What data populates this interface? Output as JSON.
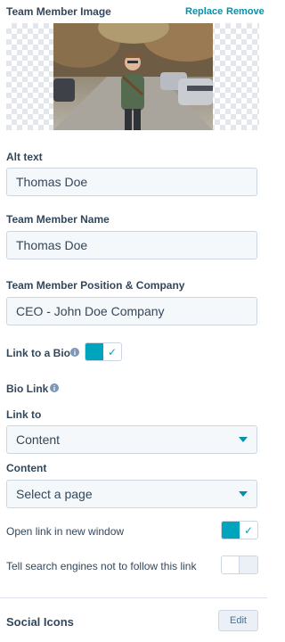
{
  "image_section": {
    "label": "Team Member Image",
    "replace_label": "Replace",
    "remove_label": "Remove"
  },
  "alt_text": {
    "label": "Alt text",
    "value": "Thomas Doe"
  },
  "name": {
    "label": "Team Member Name",
    "value": "Thomas Doe"
  },
  "position": {
    "label": "Team Member Position & Company",
    "value": "CEO - John Doe Company"
  },
  "link_to_bio": {
    "label": "Link to a Bio",
    "enabled": true,
    "info_icon": "info-icon"
  },
  "bio_link": {
    "label": "Bio Link",
    "info_icon": "info-icon"
  },
  "link_to": {
    "label": "Link to",
    "value": "Content"
  },
  "content": {
    "label": "Content",
    "placeholder": "Select a page"
  },
  "open_new_window": {
    "label": "Open link in new window",
    "enabled": true
  },
  "nofollow": {
    "label": "Tell search engines not to follow this link",
    "enabled": false
  },
  "social_icons": {
    "label": "Social Icons",
    "edit_label": "Edit"
  },
  "colors": {
    "accent": "#00a4bd",
    "link": "#0091ae",
    "text": "#33475b"
  }
}
